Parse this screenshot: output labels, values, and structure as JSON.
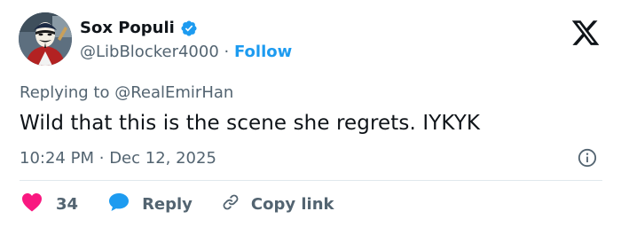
{
  "author": {
    "display_name": "Sox Populi",
    "handle": "@LibBlocker4000",
    "separator": "·",
    "follow_label": "Follow"
  },
  "tweet": {
    "replying_prefix": "Replying to",
    "replying_to": "@RealEmirHan",
    "text": "Wild that this is the scene she regrets. IYKYK",
    "time": "10:24 PM",
    "separator": "·",
    "date": "Dec 12, 2025"
  },
  "actions": {
    "like_count": "34",
    "reply_label": "Reply",
    "copy_link_label": "Copy link"
  },
  "icons": {
    "verified": "verified-badge-icon",
    "logo": "x-logo-icon",
    "info": "info-icon",
    "like": "heart-icon",
    "reply": "speech-bubble-icon",
    "copy": "link-icon"
  },
  "colors": {
    "accent": "#1d9bf0",
    "like": "#f91880",
    "text": "#0f1419",
    "secondary": "#536471"
  }
}
